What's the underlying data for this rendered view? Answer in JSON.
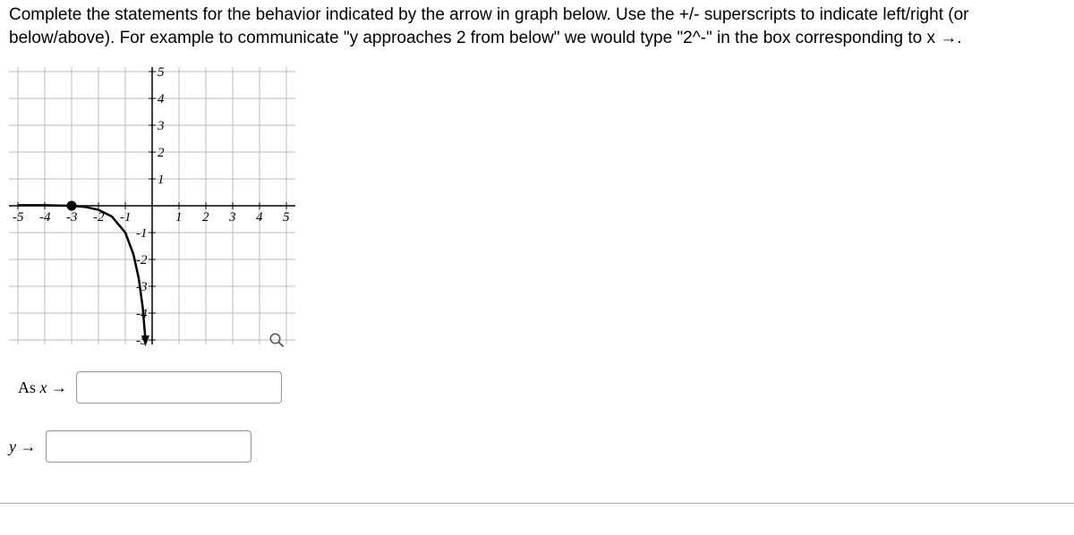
{
  "instructions": {
    "text": "Complete the statements for the behavior indicated by the arrow in graph below. Use the +/- superscripts to indicate left/right (or below/above). For example to communicate \"y approaches 2 from below\" we would type \"2^-\" in the box corresponding to x →."
  },
  "chart_data": {
    "type": "line",
    "title": "",
    "xlabel": "",
    "ylabel": "",
    "xlim": [
      -5,
      5
    ],
    "ylim": [
      -5,
      5
    ],
    "x_ticks": [
      -5,
      -4,
      -3,
      -2,
      -1,
      1,
      2,
      3,
      4,
      5
    ],
    "y_ticks": [
      -5,
      -4,
      -3,
      -2,
      -1,
      1,
      2,
      3,
      4,
      5
    ],
    "series": [
      {
        "name": "curve",
        "description": "Curve with horizontal asymptote y=0 from left, passing through solid point at (-3, 0), then descending with vertical asymptote toward x=0 from left (y → -∞)",
        "points": [
          {
            "x": -5,
            "y": 0.02
          },
          {
            "x": -4.5,
            "y": 0.02
          },
          {
            "x": -4,
            "y": 0.02
          },
          {
            "x": -3.5,
            "y": 0.01
          },
          {
            "x": -3,
            "y": 0
          },
          {
            "x": -2.5,
            "y": -0.04
          },
          {
            "x": -2,
            "y": -0.15
          },
          {
            "x": -1.5,
            "y": -0.4
          },
          {
            "x": -1,
            "y": -1
          },
          {
            "x": -0.7,
            "y": -1.8
          },
          {
            "x": -0.5,
            "y": -2.7
          },
          {
            "x": -0.35,
            "y": -3.8
          },
          {
            "x": -0.25,
            "y": -5
          }
        ],
        "solid_point": {
          "x": -3,
          "y": 0
        },
        "arrow_end": "down"
      }
    ]
  },
  "form": {
    "x_label_prefix": "As ",
    "x_var": "x",
    "arrow": " →",
    "y_var": "y",
    "x_input_value": "",
    "y_input_value": ""
  }
}
